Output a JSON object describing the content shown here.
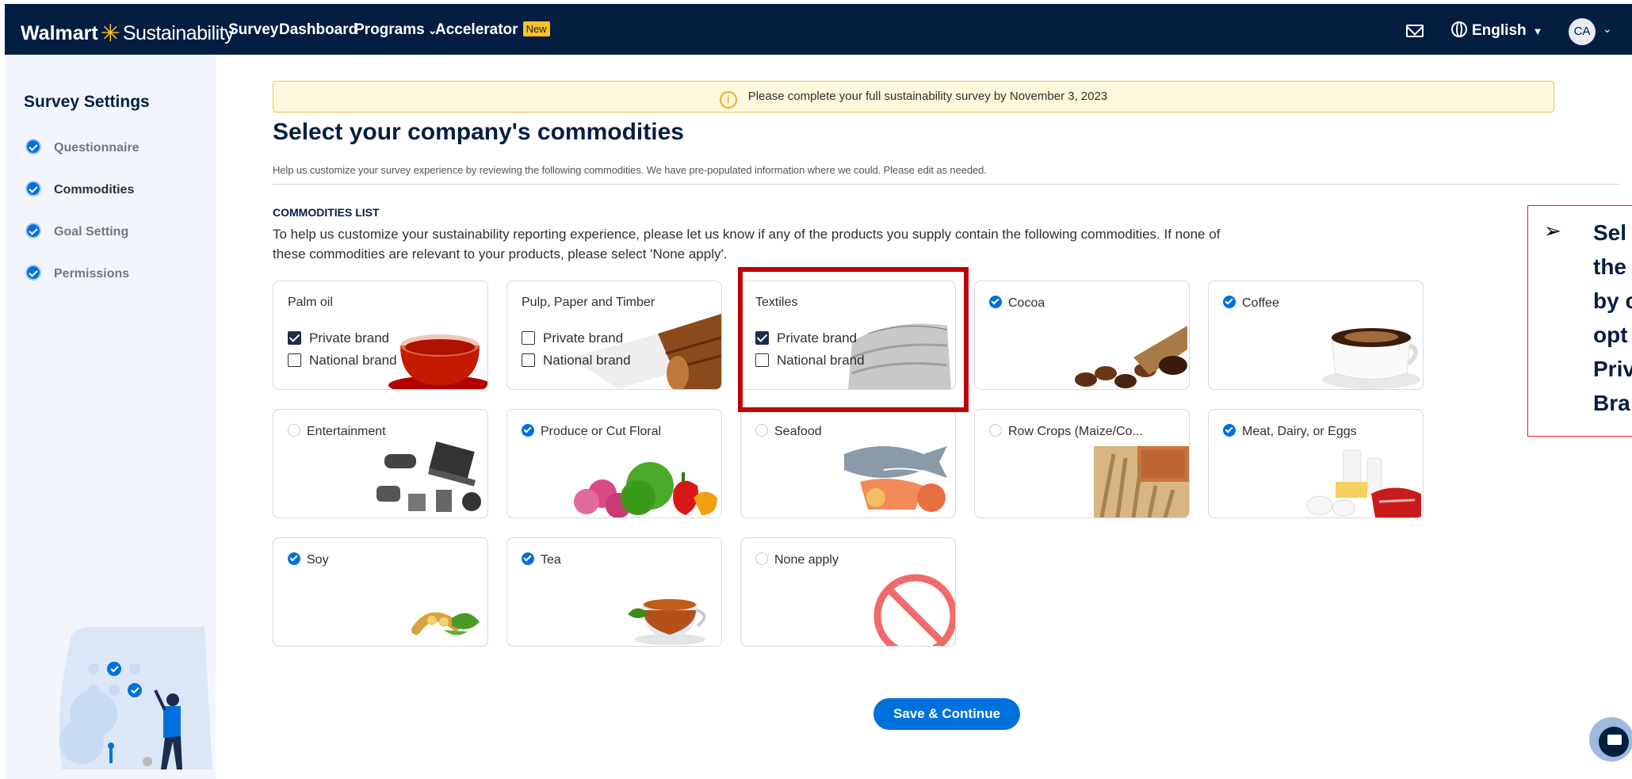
{
  "header": {
    "brand_walmart": "Walmart",
    "brand_sustainability": "Sustainability",
    "nav": [
      {
        "label": "Survey"
      },
      {
        "label": "Dashboard"
      },
      {
        "label": "Programs"
      },
      {
        "label": "Accelerator",
        "badge": "New"
      }
    ],
    "language": "English",
    "avatar_initials": "CA"
  },
  "sidebar": {
    "title": "Survey Settings",
    "items": [
      {
        "label": "Questionnaire",
        "active": false
      },
      {
        "label": "Commodities",
        "active": true
      },
      {
        "label": "Goal Setting",
        "active": false
      },
      {
        "label": "Permissions",
        "active": false
      }
    ]
  },
  "banner": {
    "text": "Please complete your full sustainability survey by November 3, 2023"
  },
  "page": {
    "title": "Select your company's commodities",
    "subtitle": "Help us customize your survey experience by reviewing the following commodities. We have pre-populated information where we could. Please edit as needed.",
    "section_heading": "COMMODITIES LIST",
    "section_description": "To help us customize your sustainability reporting experience, please let us know if any of the products you supply contain the following commodities. If none of these commodities are relevant to your products, please select 'None apply'."
  },
  "commodities": [
    {
      "name": "Palm oil",
      "options": [
        {
          "label": "Private brand",
          "checked": true
        },
        {
          "label": "National brand",
          "checked": false
        }
      ],
      "image": "palm-oil-image"
    },
    {
      "name": "Pulp, Paper and Timber",
      "options": [
        {
          "label": "Private brand",
          "checked": false
        },
        {
          "label": "National brand",
          "checked": false
        }
      ],
      "image": "timber-image"
    },
    {
      "name": "Textiles",
      "options": [
        {
          "label": "Private brand",
          "checked": true
        },
        {
          "label": "National brand",
          "checked": false
        }
      ],
      "image": "textiles-image"
    },
    {
      "name": "Cocoa",
      "selected": true,
      "image": "cocoa-image"
    },
    {
      "name": "Coffee",
      "selected": true,
      "image": "coffee-image"
    },
    {
      "name": "Entertainment",
      "selected": false,
      "image": "electronics-image"
    },
    {
      "name": "Produce or Cut Floral",
      "selected": true,
      "image": "produce-image"
    },
    {
      "name": "Seafood",
      "selected": false,
      "image": "seafood-image"
    },
    {
      "name": "Row Crops (Maize/Co...",
      "selected": false,
      "image": "grain-image"
    },
    {
      "name": "Meat, Dairy, or Eggs",
      "selected": true,
      "image": "dairy-image"
    },
    {
      "name": "Soy",
      "selected": true,
      "image": "soy-image"
    },
    {
      "name": "Tea",
      "selected": true,
      "image": "tea-image"
    },
    {
      "name": "None apply",
      "selected": false,
      "image": "prohibited-icon"
    }
  ],
  "actions": {
    "save_label": "Save & Continue"
  },
  "callout": {
    "bullet": "➢",
    "text": "Sel\nthe\nby c\nopt\nPriv\nBra"
  },
  "colors": {
    "navy": "#041e42",
    "walmart_blue": "#0071dc",
    "spark_yellow": "#ffc220",
    "highlight_red": "#c00000"
  }
}
